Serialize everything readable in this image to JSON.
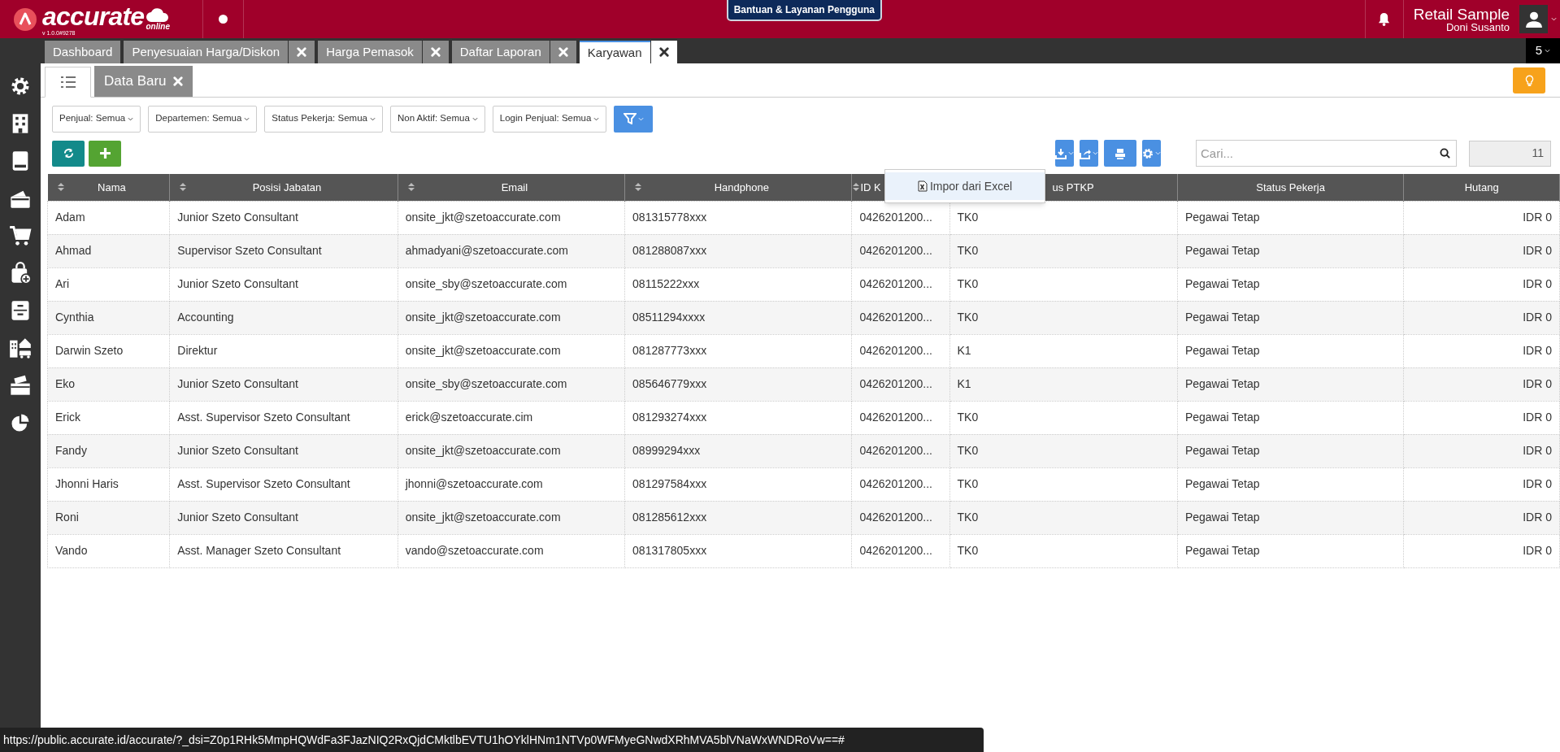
{
  "header": {
    "logo_text": "accurate",
    "logo_sub": "online",
    "version": "v 1.0.0#9278",
    "help_button": "Bantuan & Layanan Pengguna",
    "company": "Retail Sample",
    "user": "Doni Susanto"
  },
  "tabs": [
    {
      "label": "Dashboard",
      "closable": false,
      "selected": false
    },
    {
      "label": "Penyesuaian Harga/Diskon",
      "closable": true,
      "selected": false
    },
    {
      "label": "Harga Pemasok",
      "closable": true,
      "selected": false
    },
    {
      "label": "Daftar Laporan",
      "closable": true,
      "selected": false
    },
    {
      "label": "Karyawan",
      "closable": true,
      "selected": true
    }
  ],
  "tab_count": "5",
  "sub_tabs": [
    {
      "kind": "list",
      "selected": true
    },
    {
      "kind": "text",
      "label": "Data Baru",
      "selected": false
    }
  ],
  "filters": [
    "Penjual: Semua",
    "Departemen: Semua",
    "Status Pekerja: Semua",
    "Non Aktif: Semua",
    "Login Penjual: Semua"
  ],
  "search": {
    "placeholder": "Cari..."
  },
  "record_count": "11",
  "import_menu": {
    "items": [
      "Impor dari Excel"
    ]
  },
  "table": {
    "columns": [
      {
        "label": "Nama",
        "sortable": true
      },
      {
        "label": "Posisi Jabatan",
        "sortable": true
      },
      {
        "label": "Email",
        "sortable": true
      },
      {
        "label": "Handphone",
        "sortable": true
      },
      {
        "label": "ID K",
        "sortable": true
      },
      {
        "label": "us PTKP",
        "sortable": false
      },
      {
        "label": "Status Pekerja",
        "sortable": false
      },
      {
        "label": "Hutang",
        "sortable": false
      }
    ],
    "rows": [
      [
        "Adam",
        "Junior Szeto Consultant",
        "onsite_jkt@szetoaccurate.com",
        "081315778xxx",
        "0426201200...",
        "TK0",
        "Pegawai Tetap",
        "IDR 0"
      ],
      [
        "Ahmad",
        "Supervisor Szeto Consultant",
        "ahmadyani@szetoaccurate.com",
        "081288087xxx",
        "0426201200...",
        "TK0",
        "Pegawai Tetap",
        "IDR 0"
      ],
      [
        "Ari",
        "Junior Szeto Consultant",
        "onsite_sby@szetoaccurate.com",
        "08115222xxx",
        "0426201200...",
        "TK0",
        "Pegawai Tetap",
        "IDR 0"
      ],
      [
        "Cynthia",
        "Accounting",
        "onsite_jkt@szetoaccurate.com",
        "08511294xxxx",
        "0426201200...",
        "TK0",
        "Pegawai Tetap",
        "IDR 0"
      ],
      [
        "Darwin Szeto",
        "Direktur",
        "onsite_jkt@szetoaccurate.com",
        "081287773xxx",
        "0426201200...",
        "K1",
        "Pegawai Tetap",
        "IDR 0"
      ],
      [
        "Eko",
        "Junior Szeto Consultant",
        "onsite_sby@szetoaccurate.com",
        "085646779xxx",
        "0426201200...",
        "K1",
        "Pegawai Tetap",
        "IDR 0"
      ],
      [
        "Erick",
        "Asst. Supervisor Szeto Consultant",
        "erick@szetoaccurate.cim",
        "081293274xxx",
        "0426201200...",
        "TK0",
        "Pegawai Tetap",
        "IDR 0"
      ],
      [
        "Fandy",
        "Junior Szeto Consultant",
        "onsite_jkt@szetoaccurate.com",
        "08999294xxx",
        "0426201200...",
        "TK0",
        "Pegawai Tetap",
        "IDR 0"
      ],
      [
        "Jhonni Haris",
        "Asst. Supervisor Szeto Consultant",
        "jhonni@szetoaccurate.com",
        "081297584xxx",
        "0426201200...",
        "TK0",
        "Pegawai Tetap",
        "IDR 0"
      ],
      [
        "Roni",
        "Junior Szeto Consultant",
        "onsite_jkt@szetoaccurate.com",
        "081285612xxx",
        "0426201200...",
        "TK0",
        "Pegawai Tetap",
        "IDR 0"
      ],
      [
        "Vando",
        "Asst. Manager Szeto Consultant",
        "vando@szetoaccurate.com",
        "081317805xxx",
        "0426201200...",
        "TK0",
        "Pegawai Tetap",
        "IDR 0"
      ]
    ]
  },
  "status_url": "https://public.accurate.id/accurate/?_dsi=Z0p1RHk5MmpHQWdFa3FJazNIQ2RxQjdCMktlbEVTU1hOYklHNm1NTVp0WFMyeGNwdXRhMVA5blVNaWxWNDRoVw==#"
}
